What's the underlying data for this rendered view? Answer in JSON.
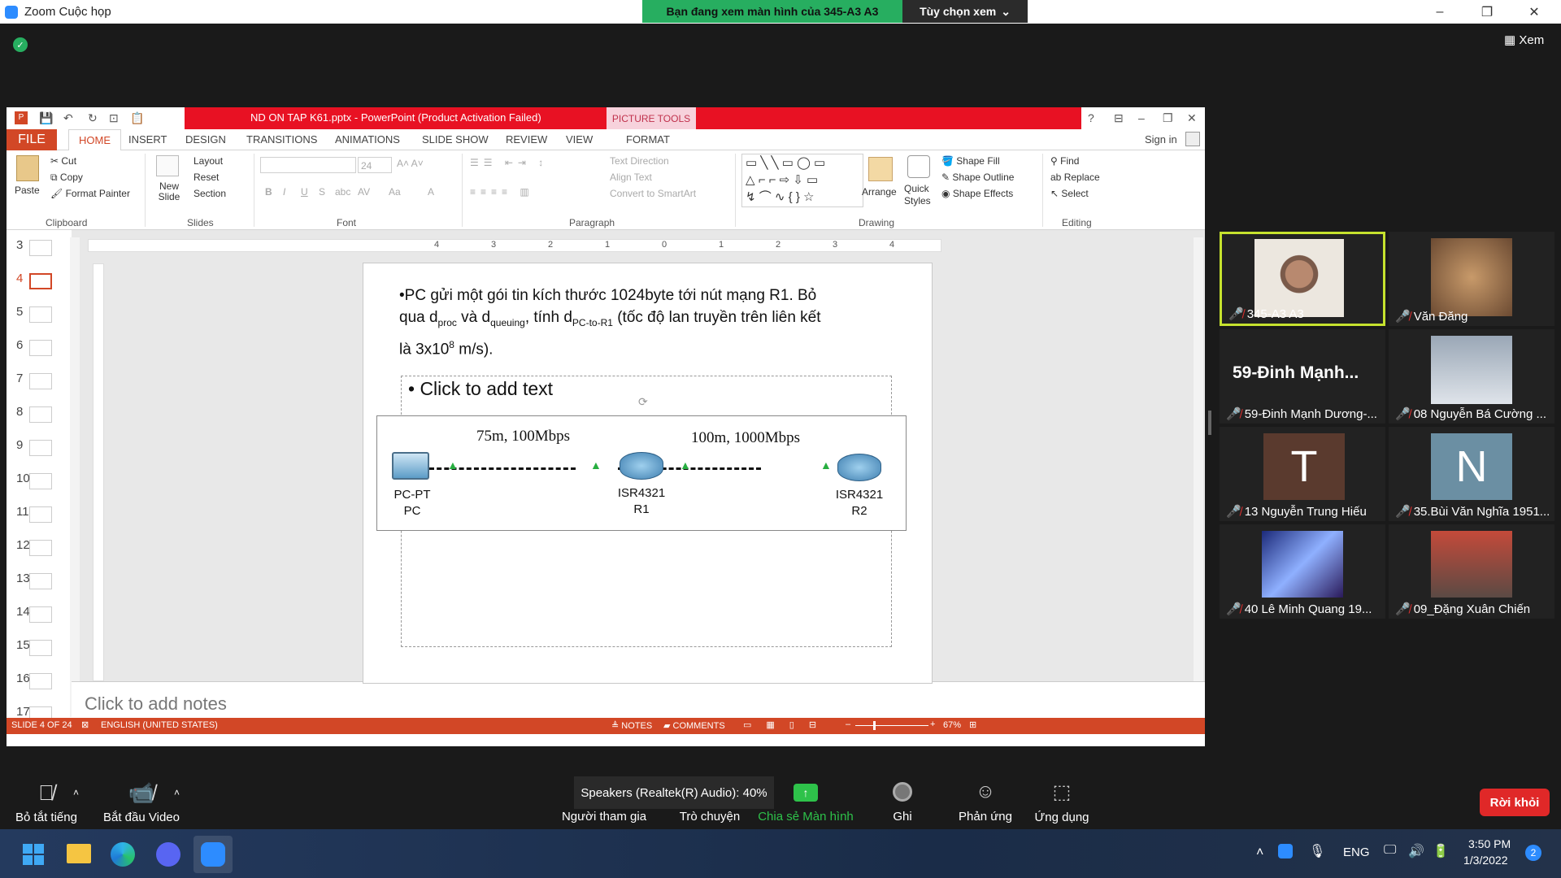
{
  "zoom": {
    "title": "Zoom Cuộc họp",
    "share_banner": "Bạn đang xem màn hình của 345-A3 A3",
    "view_options": "Tùy chọn xem",
    "view_button": "Xem"
  },
  "ppt": {
    "window_title": "ND ON TAP K61.pptx - PowerPoint (Product Activation Failed)",
    "picture_tools": "PICTURE TOOLS",
    "tabs": [
      "FILE",
      "HOME",
      "INSERT",
      "DESIGN",
      "TRANSITIONS",
      "ANIMATIONS",
      "SLIDE SHOW",
      "REVIEW",
      "VIEW",
      "FORMAT"
    ],
    "sign_in": "Sign in",
    "ribbon": {
      "paste": "Paste",
      "cut": "Cut",
      "copy": "Copy",
      "format_painter": "Format Painter",
      "new_slide": "New Slide",
      "layout": "Layout",
      "reset": "Reset",
      "section": "Section",
      "font_size": "24",
      "text_direction": "Text Direction",
      "align_text": "Align Text",
      "convert_smartart": "Convert to SmartArt",
      "arrange": "Arrange",
      "quick_styles": "Quick Styles",
      "shape_fill": "Shape Fill",
      "shape_outline": "Shape Outline",
      "shape_effects": "Shape Effects",
      "find": "Find",
      "replace": "Replace",
      "select": "Select",
      "groups": {
        "clipboard": "Clipboard",
        "slides": "Slides",
        "font": "Font",
        "paragraph": "Paragraph",
        "drawing": "Drawing",
        "editing": "Editing"
      }
    },
    "slide_numbers": [
      "3",
      "4",
      "5",
      "6",
      "7",
      "8",
      "9",
      "10",
      "11",
      "12",
      "13",
      "14",
      "15",
      "16",
      "17"
    ],
    "ruler_labels": [
      "4",
      "3",
      "2",
      "1",
      "0",
      "1",
      "2",
      "3",
      "4"
    ],
    "slide": {
      "line1": "•PC gửi một gói tin kích thước 1024byte tới nút mạng R1. Bỏ",
      "line2_a": "qua d",
      "sub_proc": "proc",
      "line2_b": " và d",
      "sub_queuing": "queuing",
      "line2_c": ", tính d",
      "sub_pc_r1": "PC-to-R1",
      "line2_d": " (tốc độ lan truyền trên liên kết",
      "line3_a": "là 3x10",
      "sup_8": "8",
      "line3_b": " m/s).",
      "placeholder": "• Click to add text",
      "link1": "75m,  100Mbps",
      "link2": "100m, 1000Mbps",
      "pc_label1": "PC-PT",
      "pc_label2": "PC",
      "r1_label1": "ISR4321",
      "r1_label2": "R1",
      "r2_label1": "ISR4321",
      "r2_label2": "R2"
    },
    "notes_placeholder": "Click to add notes",
    "status": {
      "slide": "SLIDE 4 OF 24",
      "language": "ENGLISH (UNITED STATES)",
      "notes": "NOTES",
      "comments": "COMMENTS",
      "zoom": "67%"
    }
  },
  "participants": [
    {
      "name": "345-A3 A3"
    },
    {
      "name": "Văn Đăng"
    },
    {
      "name": "59-Đinh Mạnh Dương-...",
      "display": "59-Đinh  Mạnh..."
    },
    {
      "name": "08 Nguyễn Bá Cường ..."
    },
    {
      "name": "13 Nguyễn Trung Hiếu",
      "initial": "T"
    },
    {
      "name": "35.Bùi Văn Nghĩa 1951...",
      "initial": "N"
    },
    {
      "name": "40 Lê Minh Quang 19..."
    },
    {
      "name": "09_Đặng Xuân Chiến"
    }
  ],
  "toolbar": {
    "mute": "Bỏ tắt tiếng",
    "video": "Bắt đầu Video",
    "speaker_popup": "Speakers (Realtek(R) Audio): 40%",
    "participants": "Người tham gia",
    "chat": "Trò chuyện",
    "share": "Chia sẻ Màn hình",
    "record": "Ghi",
    "reactions": "Phản ứng",
    "apps": "Ứng dụng",
    "leave": "Rời khỏi"
  },
  "taskbar": {
    "lang": "ENG",
    "time": "3:50 PM",
    "date": "1/3/2022",
    "notif_count": "2"
  },
  "colors": {
    "ppt_accent": "#d24726",
    "title_red": "#e81123",
    "share_green": "#27ae60",
    "active_speaker": "#c6e22e"
  }
}
